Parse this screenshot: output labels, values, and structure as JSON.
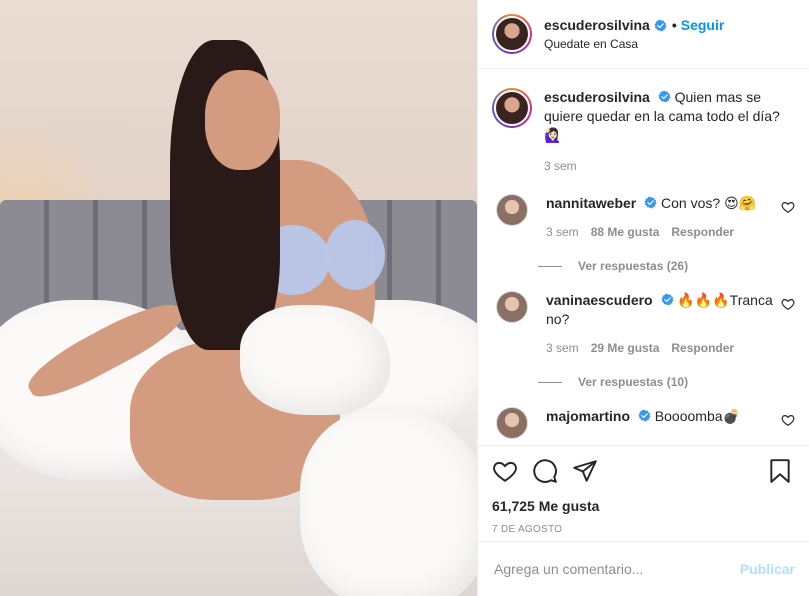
{
  "post": {
    "author": "escuderosilvina",
    "follow_label": "Seguir",
    "separator": "•",
    "location": "Quedate en Casa",
    "caption": {
      "username": "escuderosilvina",
      "text": "Quien mas se quiere quedar en la cama todo el día? 🙋🏻‍♀️",
      "time": "3 sem"
    },
    "comments": [
      {
        "username": "nannitaweber",
        "text": "Con vos? 😍🤗",
        "time": "3 sem",
        "likes": "88 Me gusta",
        "reply_label": "Responder",
        "replies_label": "Ver respuestas (26)"
      },
      {
        "username": "vaninaescudero",
        "text": "🔥🔥🔥Tranca no?",
        "time": "3 sem",
        "likes": "29 Me gusta",
        "reply_label": "Responder",
        "replies_label": "Ver respuestas (10)"
      },
      {
        "username": "majomartino",
        "text": "Boooomba💣"
      }
    ],
    "likes_count": "61,725 Me gusta",
    "date": "7 DE AGOSTO",
    "comment_placeholder": "Agrega un comentario...",
    "publish_label": "Publicar",
    "icons": {
      "like": "heart-icon",
      "comment": "comment-icon",
      "share": "share-icon",
      "save": "bookmark-icon",
      "verified": "verified-badge-icon"
    },
    "colors": {
      "follow": "#0095f6",
      "verified": "#3897f0",
      "publish_disabled": "#b2dffc",
      "muted": "#8e8e8e"
    }
  }
}
